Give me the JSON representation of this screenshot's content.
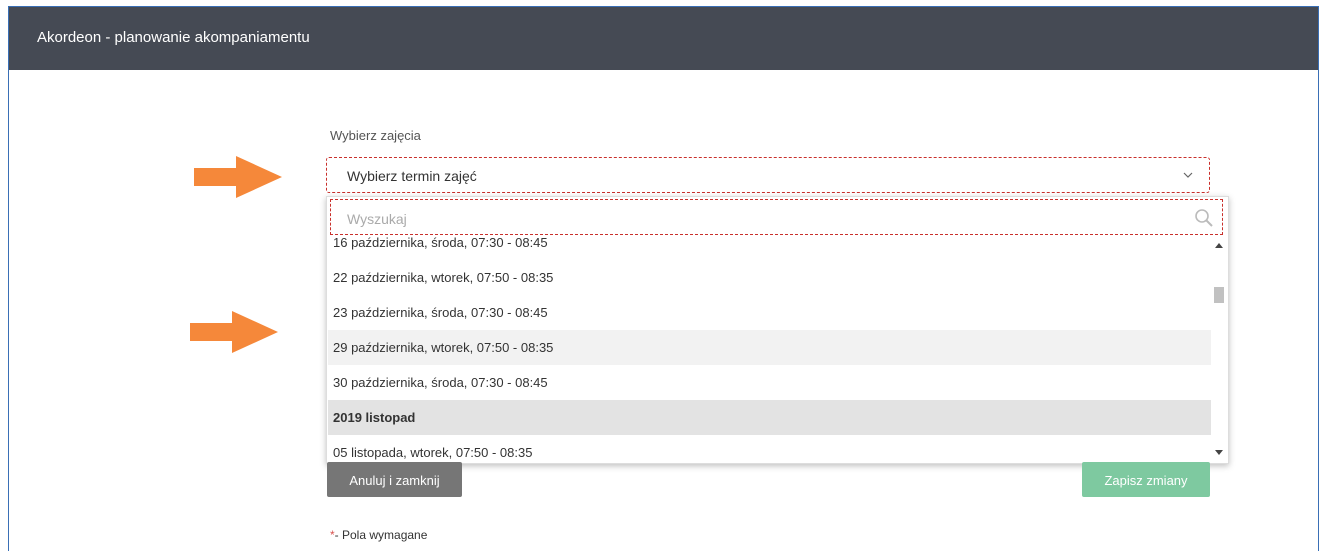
{
  "window": {
    "title": "Akordeon - planowanie akompaniamentu"
  },
  "form": {
    "field_label": "Wybierz zajęcia",
    "select_value": "Wybierz termin zajęć",
    "search_placeholder": "Wyszukaj"
  },
  "options": [
    {
      "label": "16 października, środa, 07:30 - 08:45",
      "type": "option"
    },
    {
      "label": "22 października, wtorek, 07:50 - 08:35",
      "type": "option"
    },
    {
      "label": "23 października, środa, 07:30 - 08:45",
      "type": "option"
    },
    {
      "label": "29 października, wtorek, 07:50 - 08:35",
      "type": "option",
      "hovered": true
    },
    {
      "label": "30 października, środa, 07:30 - 08:45",
      "type": "option"
    },
    {
      "label": "2019 listopad",
      "type": "group"
    },
    {
      "label": "05 listopada, wtorek, 07:50 - 08:35",
      "type": "option"
    }
  ],
  "buttons": {
    "cancel": "Anuluj i zamknij",
    "save": "Zapisz zmiany"
  },
  "footer": {
    "required_star": "*",
    "required_text": "- Pola wymagane"
  },
  "colors": {
    "titlebar": "#454a54",
    "arrow": "#f5883a",
    "save": "#7ec9a0",
    "cancel": "#767676",
    "required": "#c9302c"
  },
  "icons": [
    "chevron-down-icon",
    "search-icon",
    "arrow-right-icon"
  ]
}
